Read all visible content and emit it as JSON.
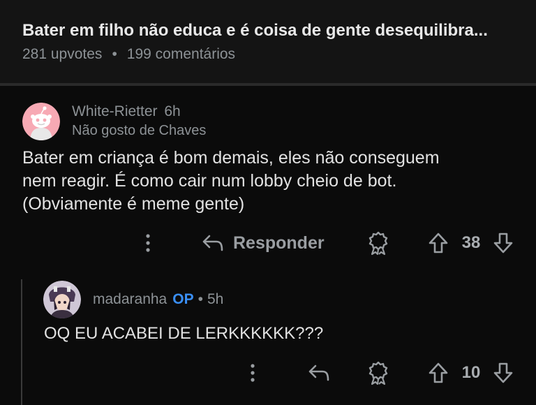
{
  "post": {
    "title": "Bater em filho não educa e é coisa de gente desequilibra...",
    "upvotes": "281 upvotes",
    "separator": "•",
    "comments": "199 comentários"
  },
  "comments": [
    {
      "username": "White-Rietter",
      "age": "6h",
      "flair": "Não gosto de Chaves",
      "body_lines": [
        "Bater em criança é bom demais, eles não conseguem",
        "nem reagir. É como cair num lobby cheio de bot.",
        "(Obviamente é meme gente)"
      ],
      "reply_label": "Responder",
      "votes": "38",
      "avatar_icon": "snoo-avatar-icon"
    },
    {
      "username": "madaranha",
      "op_badge": "OP",
      "separator": "•",
      "age": "5h",
      "body": "OQ EU ACABEI DE LERKKKKKK???",
      "votes": "10",
      "avatar_icon": "anime-avatar-icon"
    }
  ],
  "colors": {
    "background": "#0b0b0b",
    "header_background": "#141414",
    "op_badge": "#3a8ff5",
    "muted_text": "#8d9296"
  }
}
